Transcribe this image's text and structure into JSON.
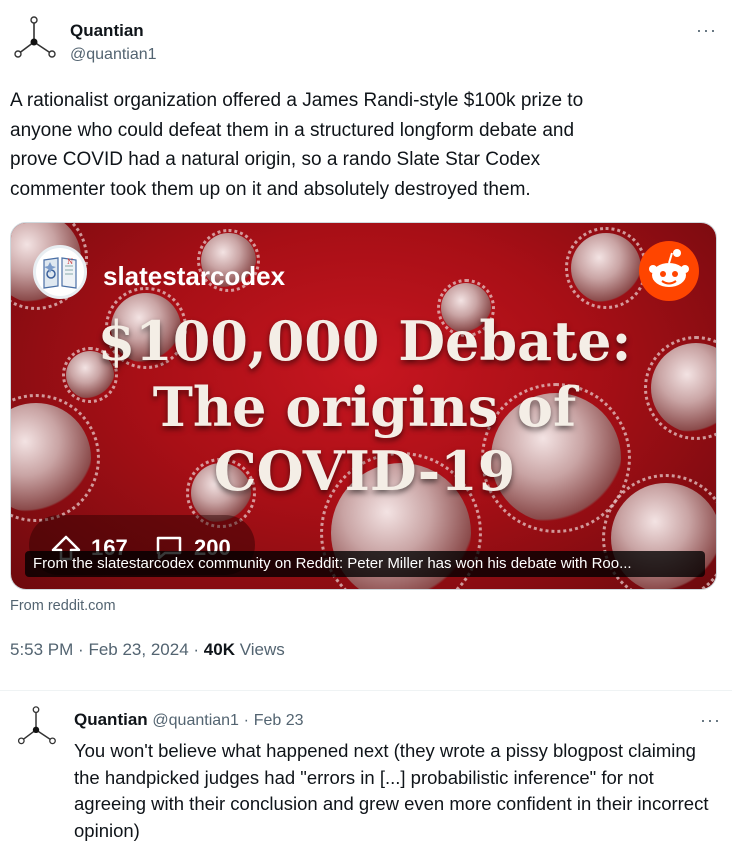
{
  "tweet": {
    "author_name": "Quantian",
    "author_handle": "@quantian1",
    "more_label": "···",
    "text": "A rationalist organization offered a James Randi-style $100k prize to\nanyone who could defeat them in a structured longform debate and\nprove COVID had a natural origin, so a rando Slate Star Codex\ncommenter took them up on it and absolutely destroyed them.",
    "card": {
      "subreddit": "slatestarcodex",
      "headline_line1": "$100,000 Debate:",
      "headline_line2": "The origins of",
      "headline_line3": "COVID-19",
      "upvotes": "167",
      "comments": "200",
      "caption": "From the slatestarcodex community on Reddit: Peter Miller has won his debate with Roo...",
      "icons": [
        "upvote-icon",
        "comment-icon",
        "reddit-logo"
      ],
      "accent_color": "#c71620"
    },
    "from_domain": "From reddit.com",
    "time": "5:53 PM",
    "date": "Feb 23, 2024",
    "dot": "·",
    "views_count": "40K",
    "views_label": "Views"
  },
  "reply": {
    "author_name": "Quantian",
    "author_handle": "@quantian1",
    "separator": "·",
    "date": "Feb 23",
    "more_label": "···",
    "text": "You won't believe what happened next (they wrote a pissy blogpost claiming the handpicked judges had \"errors in [...] probabilistic inference\" for not agreeing with their conclusion and grew even more confident in their incorrect opinion)"
  },
  "colors": {
    "text_primary": "#0f1419",
    "text_secondary": "#536471",
    "border": "#cfd9de",
    "reddit_orange": "#ff4500"
  }
}
